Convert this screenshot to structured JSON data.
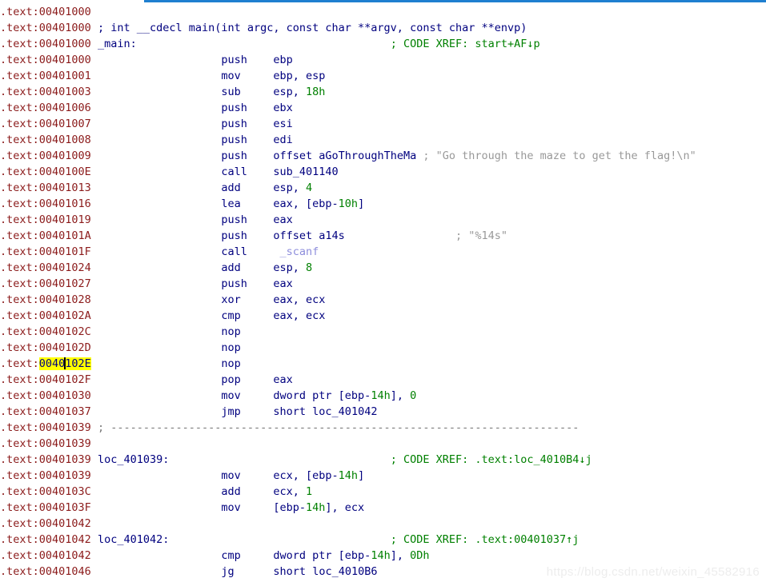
{
  "window": {
    "app": "IDA Pro",
    "view": "IDA View-A",
    "segment": ".text",
    "accent_color": "#1f7fd0"
  },
  "colors": {
    "address": "#8b1a1a",
    "mnemonic": "#00007f",
    "operand": "#00007f",
    "number": "#008000",
    "label": "#00007f",
    "api_call": "#8e8edc",
    "xref_comment": "#008000",
    "string_comment": "#999999",
    "separator": "#777777",
    "highlight_bg": "#ffff00",
    "background": "#ffffff"
  },
  "cursor": {
    "line_index": 22,
    "address": "0040102E",
    "highlighted_text": "0040102E",
    "caret_after_chars": 4
  },
  "watermark": "https://blog.csdn.net/weixin_45582916",
  "listing": [
    {
      "addr": ".text:00401000",
      "kind": "blank"
    },
    {
      "addr": ".text:00401000",
      "kind": "comment",
      "comment": "; int __cdecl main(int argc, const char **argv, const char **envp)"
    },
    {
      "addr": ".text:00401000",
      "kind": "label",
      "label": "_main:",
      "xref": "; CODE XREF: start+AF↓p"
    },
    {
      "addr": ".text:00401000",
      "kind": "insn",
      "mnemonic": "push",
      "operands": [
        {
          "t": "op",
          "v": "ebp"
        }
      ]
    },
    {
      "addr": ".text:00401001",
      "kind": "insn",
      "mnemonic": "mov",
      "operands": [
        {
          "t": "op",
          "v": "ebp, esp"
        }
      ]
    },
    {
      "addr": ".text:00401003",
      "kind": "insn",
      "mnemonic": "sub",
      "operands": [
        {
          "t": "op",
          "v": "esp, "
        },
        {
          "t": "num",
          "v": "18h"
        }
      ]
    },
    {
      "addr": ".text:00401006",
      "kind": "insn",
      "mnemonic": "push",
      "operands": [
        {
          "t": "op",
          "v": "ebx"
        }
      ]
    },
    {
      "addr": ".text:00401007",
      "kind": "insn",
      "mnemonic": "push",
      "operands": [
        {
          "t": "op",
          "v": "esi"
        }
      ]
    },
    {
      "addr": ".text:00401008",
      "kind": "insn",
      "mnemonic": "push",
      "operands": [
        {
          "t": "op",
          "v": "edi"
        }
      ]
    },
    {
      "addr": ".text:00401009",
      "kind": "insn",
      "mnemonic": "push",
      "operands": [
        {
          "t": "op",
          "v": "offset "
        },
        {
          "t": "lbl",
          "v": "aGoThroughTheMa"
        }
      ],
      "strcomment": "; \"Go through the maze to get the flag!\\n\""
    },
    {
      "addr": ".text:0040100E",
      "kind": "insn",
      "mnemonic": "call",
      "operands": [
        {
          "t": "lbl",
          "v": "sub_401140"
        }
      ]
    },
    {
      "addr": ".text:00401013",
      "kind": "insn",
      "mnemonic": "add",
      "operands": [
        {
          "t": "op",
          "v": "esp, "
        },
        {
          "t": "num",
          "v": "4"
        }
      ]
    },
    {
      "addr": ".text:00401016",
      "kind": "insn",
      "mnemonic": "lea",
      "operands": [
        {
          "t": "op",
          "v": "eax, [ebp-"
        },
        {
          "t": "num",
          "v": "10h"
        },
        {
          "t": "op",
          "v": "]"
        }
      ]
    },
    {
      "addr": ".text:00401019",
      "kind": "insn",
      "mnemonic": "push",
      "operands": [
        {
          "t": "op",
          "v": "eax"
        }
      ]
    },
    {
      "addr": ".text:0040101A",
      "kind": "insn",
      "mnemonic": "push",
      "operands": [
        {
          "t": "op",
          "v": "offset "
        },
        {
          "t": "lbl",
          "v": "a14s"
        }
      ],
      "strcomment": "; \"%14s\"",
      "strcomment_col": 28
    },
    {
      "addr": ".text:0040101F",
      "kind": "insn",
      "mnemonic": "call",
      "operands": [
        {
          "t": "api",
          "v": " _scanf"
        }
      ]
    },
    {
      "addr": ".text:00401024",
      "kind": "insn",
      "mnemonic": "add",
      "operands": [
        {
          "t": "op",
          "v": "esp, "
        },
        {
          "t": "num",
          "v": "8"
        }
      ]
    },
    {
      "addr": ".text:00401027",
      "kind": "insn",
      "mnemonic": "push",
      "operands": [
        {
          "t": "op",
          "v": "eax"
        }
      ]
    },
    {
      "addr": ".text:00401028",
      "kind": "insn",
      "mnemonic": "xor",
      "operands": [
        {
          "t": "op",
          "v": "eax, ecx"
        }
      ]
    },
    {
      "addr": ".text:0040102A",
      "kind": "insn",
      "mnemonic": "cmp",
      "operands": [
        {
          "t": "op",
          "v": "eax, ecx"
        }
      ]
    },
    {
      "addr": ".text:0040102C",
      "kind": "insn",
      "mnemonic": "nop",
      "operands": []
    },
    {
      "addr": ".text:0040102D",
      "kind": "insn",
      "mnemonic": "nop",
      "operands": []
    },
    {
      "addr": ".text:0040102E",
      "kind": "insn",
      "mnemonic": "nop",
      "operands": [],
      "highlight": true
    },
    {
      "addr": ".text:0040102F",
      "kind": "insn",
      "mnemonic": "pop",
      "operands": [
        {
          "t": "op",
          "v": "eax"
        }
      ]
    },
    {
      "addr": ".text:00401030",
      "kind": "insn",
      "mnemonic": "mov",
      "operands": [
        {
          "t": "op",
          "v": "dword ptr [ebp-"
        },
        {
          "t": "num",
          "v": "14h"
        },
        {
          "t": "op",
          "v": "], "
        },
        {
          "t": "num",
          "v": "0"
        }
      ]
    },
    {
      "addr": ".text:00401037",
      "kind": "insn",
      "mnemonic": "jmp",
      "operands": [
        {
          "t": "op",
          "v": "short "
        },
        {
          "t": "lbl",
          "v": "loc_401042"
        }
      ]
    },
    {
      "addr": ".text:00401039",
      "kind": "separator",
      "separator": "; ------------------------------------------------------------------------"
    },
    {
      "addr": ".text:00401039",
      "kind": "blank"
    },
    {
      "addr": ".text:00401039",
      "kind": "label",
      "label": "loc_401039:",
      "xref": "; CODE XREF: .text:loc_4010B4↓j"
    },
    {
      "addr": ".text:00401039",
      "kind": "insn",
      "mnemonic": "mov",
      "operands": [
        {
          "t": "op",
          "v": "ecx, [ebp-"
        },
        {
          "t": "num",
          "v": "14h"
        },
        {
          "t": "op",
          "v": "]"
        }
      ]
    },
    {
      "addr": ".text:0040103C",
      "kind": "insn",
      "mnemonic": "add",
      "operands": [
        {
          "t": "op",
          "v": "ecx, "
        },
        {
          "t": "num",
          "v": "1"
        }
      ]
    },
    {
      "addr": ".text:0040103F",
      "kind": "insn",
      "mnemonic": "mov",
      "operands": [
        {
          "t": "op",
          "v": "[ebp-"
        },
        {
          "t": "num",
          "v": "14h"
        },
        {
          "t": "op",
          "v": "], ecx"
        }
      ]
    },
    {
      "addr": ".text:00401042",
      "kind": "blank"
    },
    {
      "addr": ".text:00401042",
      "kind": "label",
      "label": "loc_401042:",
      "xref": "; CODE XREF: .text:00401037↑j"
    },
    {
      "addr": ".text:00401042",
      "kind": "insn",
      "mnemonic": "cmp",
      "operands": [
        {
          "t": "op",
          "v": "dword ptr [ebp-"
        },
        {
          "t": "num",
          "v": "14h"
        },
        {
          "t": "op",
          "v": "], "
        },
        {
          "t": "num",
          "v": "0Dh"
        }
      ]
    },
    {
      "addr": ".text:00401046",
      "kind": "insn",
      "mnemonic": "jg",
      "operands": [
        {
          "t": "op",
          "v": "short "
        },
        {
          "t": "lbl",
          "v": "loc_4010B6"
        }
      ]
    }
  ]
}
